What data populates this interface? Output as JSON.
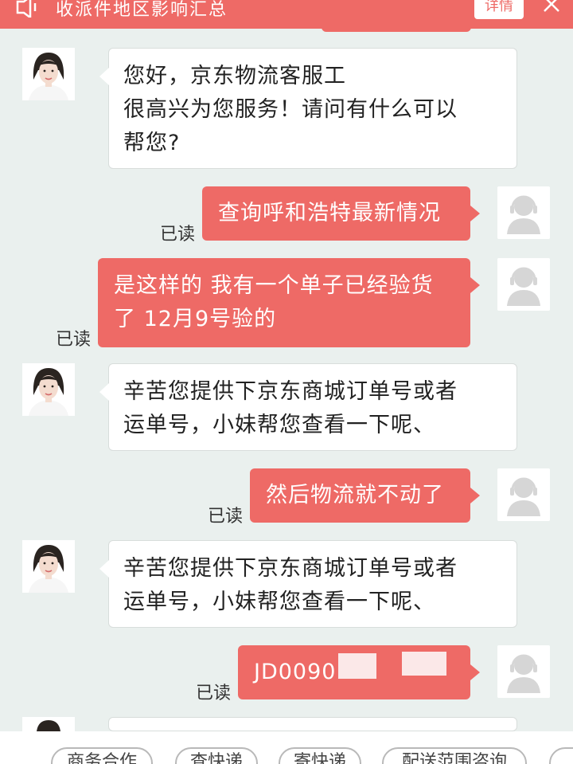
{
  "banner": {
    "title": "收派件地区影响汇总",
    "detail_label": "详情",
    "speaker_icon": "speaker-icon",
    "close_icon": "close-icon"
  },
  "messages": [
    {
      "from": "agent",
      "lines": [
        "您好，京东物流客服工",
        "很高兴为您服务！请问有什么可以",
        "帮您?"
      ]
    },
    {
      "from": "user",
      "text": "查询呼和浩特最新情况",
      "status": "已读"
    },
    {
      "from": "user",
      "lines": [
        "是这样的 我有一个单子已经验货",
        "了 12月9号验的"
      ],
      "status": "已读"
    },
    {
      "from": "agent",
      "lines": [
        "辛苦您提供下京东商城订单号或者",
        "运单号，小妹帮您查看一下呢、"
      ]
    },
    {
      "from": "user",
      "text": "然后物流就不动了",
      "status": "已读"
    },
    {
      "from": "agent",
      "lines": [
        "辛苦您提供下京东商城订单号或者",
        "运单号，小妹帮您查看一下呢、"
      ]
    },
    {
      "from": "user",
      "text": "JD0090",
      "status": "已读"
    }
  ],
  "quick_replies": [
    "商务合作",
    "查快递",
    "寄快递",
    "配送范围咨询"
  ],
  "colors": {
    "accent": "#ee6a66",
    "background": "#eaf0ee",
    "bubble_agent": "#ffffff",
    "text_dark": "#222222"
  }
}
